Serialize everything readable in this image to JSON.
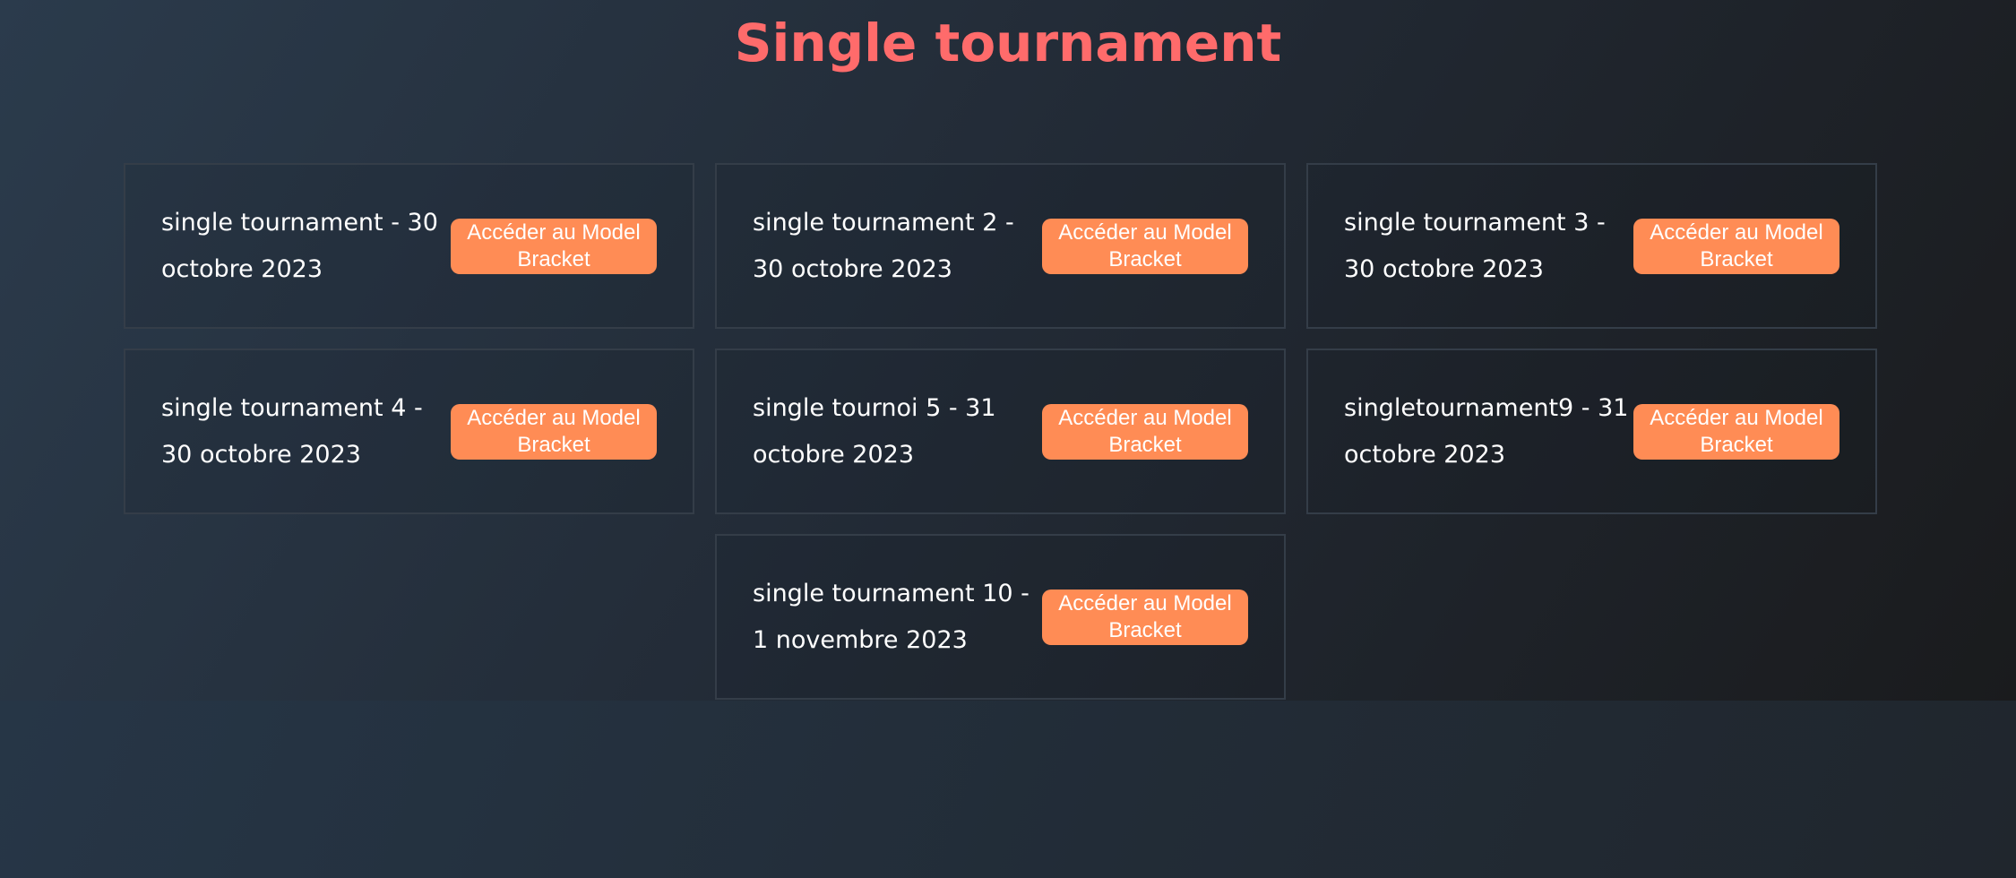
{
  "title": "Single tournament",
  "button_label": "Accéder au Model Bracket",
  "tournaments": [
    {
      "name": "single tournament - 30 octobre 2023"
    },
    {
      "name": "single tournament 2 - 30 octobre 2023"
    },
    {
      "name": "single tournament 3 - 30 octobre 2023"
    },
    {
      "name": "single tournament 4 - 30 octobre 2023"
    },
    {
      "name": "single tournoi 5 - 31 octobre 2023"
    },
    {
      "name": "singletournament9 - 31 octobre 2023"
    },
    {
      "name": "single tournament 10 - 1 novembre 2023"
    }
  ],
  "colors": {
    "title": "#ff6b6b",
    "button": "#ff8c55"
  }
}
